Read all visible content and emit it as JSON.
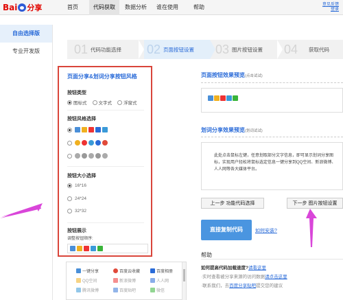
{
  "header": {
    "logo_bai": "Bai",
    "logo_du": "分享",
    "nav": [
      {
        "label": "首页",
        "active": false
      },
      {
        "label": "代码获取",
        "active": true
      },
      {
        "label": "数据分析",
        "active": false
      },
      {
        "label": "谁在使用",
        "active": false
      },
      {
        "label": "帮助",
        "active": false
      }
    ],
    "links": [
      "意见反馈",
      "登录"
    ]
  },
  "left_menu": [
    {
      "label": "自由选择版",
      "active": true
    },
    {
      "label": "专业开发版",
      "active": false
    }
  ],
  "steps": [
    {
      "num": "01",
      "label": "代码功能选择"
    },
    {
      "num": "02",
      "label": "页面按钮设置"
    },
    {
      "num": "03",
      "label": "图片按钮设置"
    },
    {
      "num": "04",
      "label": "获取代码"
    }
  ],
  "config": {
    "title": "页面分享&划词分享按钮风格",
    "type_title": "按钮类型",
    "type_options": [
      "图标式",
      "文字式",
      "浮窗式"
    ],
    "style_title": "按钮风格选择",
    "size_title": "按钮大小选择",
    "sizes": [
      "16*16",
      "24*24",
      "32*32"
    ],
    "display_title": "按钮展示",
    "display_sub": "调整按钮顺序:"
  },
  "services": [
    {
      "label": "一键分享",
      "icon": "share-icon",
      "color": "#4a8fd8"
    },
    {
      "label": "百度云收藏",
      "icon": "heart-icon",
      "color": "#e04a3a"
    },
    {
      "label": "百度相册",
      "icon": "album-icon",
      "color": "#2a6bd8"
    },
    {
      "label": "QQ空间",
      "icon": "qzone-icon",
      "color": "#f0b020"
    },
    {
      "label": "新浪微博",
      "icon": "weibo-icon",
      "color": "#e33"
    },
    {
      "label": "人人网",
      "icon": "renren-icon",
      "color": "#2a6bd8"
    },
    {
      "label": "腾讯微博",
      "icon": "tweibo-icon",
      "color": "#3a9ad8"
    },
    {
      "label": "百度贴吧",
      "icon": "tieba-icon",
      "color": "#3a7ad8"
    },
    {
      "label": "微信",
      "icon": "wechat-icon",
      "color": "#3ab43a"
    }
  ],
  "preview": {
    "page_title": "页面按钮效果预览",
    "page_hint": "(点击试试)",
    "select_title": "划词分享效果预览",
    "select_hint": "(划词试试)",
    "select_text": "此处点击鼠标左键，任意划取部分文字信息，即可显示划词分享图标，实现用户轻松将鼠标选定信息一键分享到QQ空间、新浪微博、人人网等各大媒体平台。"
  },
  "buttons": {
    "prev": "上一步 功能代码选择",
    "next": "下一步 图片按钮设置",
    "copy": "直接复制代码",
    "install": "如何安装?"
  },
  "help": {
    "title": "帮助",
    "items": [
      {
        "prefix": "如何提高代码加载速度?",
        "link": "请看这里"
      },
      {
        "prefix": "·实时查看被分享来源的访问数据",
        "link": "请点击这里"
      },
      {
        "prefix": "·联系我们，去",
        "link": "百度分享贴吧",
        "suffix": "提交您的建议"
      }
    ]
  },
  "colors": {
    "accent": "#2a6bd8",
    "highlight_border": "#d9453a",
    "annotation_arrow": "#d946d9"
  }
}
